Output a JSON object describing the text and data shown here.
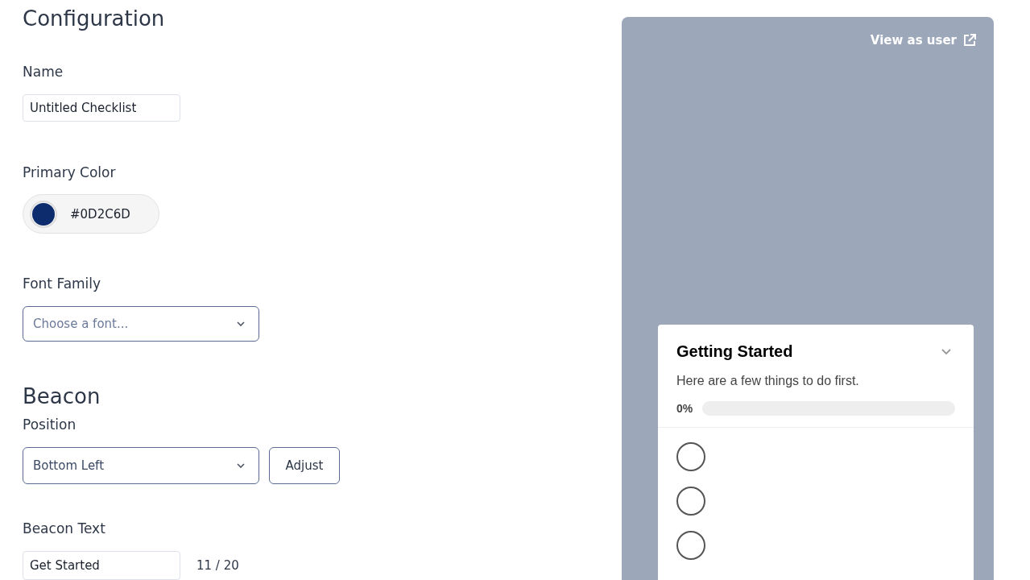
{
  "configuration": {
    "title": "Configuration",
    "name": {
      "label": "Name",
      "value": "Untitled Checklist"
    },
    "primary_color": {
      "label": "Primary Color",
      "value": "#0D2C6D",
      "color": "#0d2c6d"
    },
    "font_family": {
      "label": "Font Family",
      "placeholder": "Choose a font..."
    }
  },
  "beacon": {
    "title": "Beacon",
    "position": {
      "label": "Position",
      "value": "Bottom Left",
      "button": "Adjust"
    },
    "beacon_text": {
      "label": "Beacon Text",
      "value": "Get Started",
      "counter": "11 / 20"
    }
  },
  "preview": {
    "link": "View as user",
    "checklist": {
      "title": "Getting Started",
      "description": "Here are a few things to do first.",
      "progress": {
        "reading": "0%",
        "level": 0
      },
      "items": [
        {
          "checked": false
        },
        {
          "checked": false
        },
        {
          "checked": false
        }
      ]
    }
  }
}
